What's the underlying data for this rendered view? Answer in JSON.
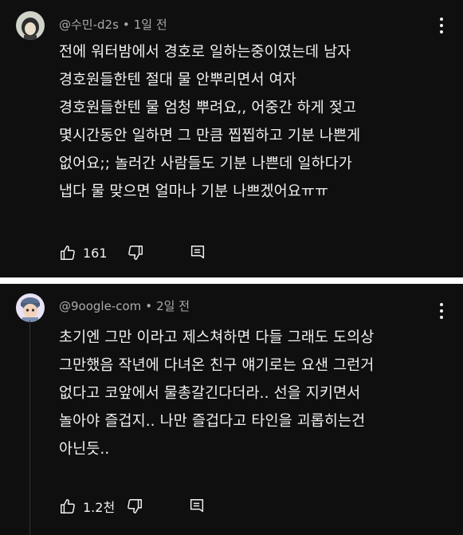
{
  "comments": [
    {
      "handle": "@수민-d2s",
      "separator": "•",
      "time": "1일 전",
      "lines": [
        "전에 워터밤에서 경호로 일하는중이였는데 남자",
        "경호원들한텐 절대 물 안뿌리면서 여자",
        "경호원들한텐 물 엄청 뿌려요,, 어중간 하게 젖고",
        "몇시간동안 일하면 그 만큼 찝찝하고 기분 나쁜게",
        "없어요;;  놀러간 사람들도 기분 나쁜데 일하다가",
        "냅다 물 맞으면 얼마나 기분 나쁘겠어요ㅠㅠ"
      ],
      "likes": "161",
      "avatar_colors": {
        "bg": "#cfd3c8",
        "hair": "#2b2b2b",
        "face": "#e9dcc9"
      }
    },
    {
      "handle": "@9oogle-com",
      "separator": "•",
      "time": "2일 전",
      "lines": [
        "초기엔 그만 이라고 제스쳐하면 다들 그래도 도의상",
        "그만했음 작년에 다녀온 친구 얘기로는 요샌 그런거",
        "없다고 코앞에서 물총갈긴다더라.. 선을 지키면서",
        "놀아야 즐겁지.. 나만 즐겁다고 타인을 괴롭히는건",
        "아닌듯.."
      ],
      "likes": "1.2천",
      "avatar_colors": {
        "bg": "#e9e2f4",
        "hair": "#5a6f8f",
        "face": "#f2d3bb"
      }
    }
  ],
  "icons": [
    "thumb-up-icon",
    "thumb-down-icon",
    "reply-icon",
    "more-vert-icon"
  ],
  "colors": {
    "background": "#0f0f0f",
    "text": "#f1f1f1",
    "meta": "#aaaaaa",
    "divider": "#ffffff"
  }
}
